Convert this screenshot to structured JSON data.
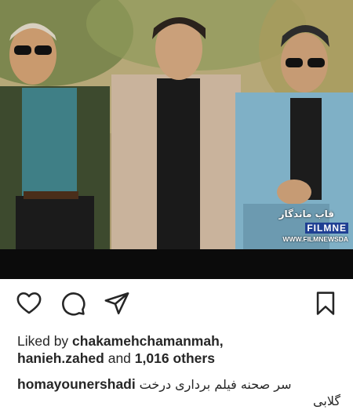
{
  "post": {
    "likes_prefix": "Liked by ",
    "liker_1": "chakamehchamanmah,",
    "liker_2": "hanieh.zahed",
    "and_text": " and ",
    "others": "1,016 others",
    "username": "homayounershadi",
    "caption_line1": "سر صحنه فیلم برداری درخت",
    "caption_line2": "گلابی"
  },
  "watermark": {
    "title": "قاب ماندگار",
    "logo_text": "FILMNE",
    "url": "WWW.FILMNEWSDA"
  },
  "icons": {
    "like": "heart-icon",
    "comment": "comment-bubble-icon",
    "share": "paper-plane-icon",
    "save": "bookmark-icon"
  },
  "colors": {
    "text": "#262626",
    "bar": "#0b0b0b",
    "watermark_blue": "#1f3f93"
  }
}
